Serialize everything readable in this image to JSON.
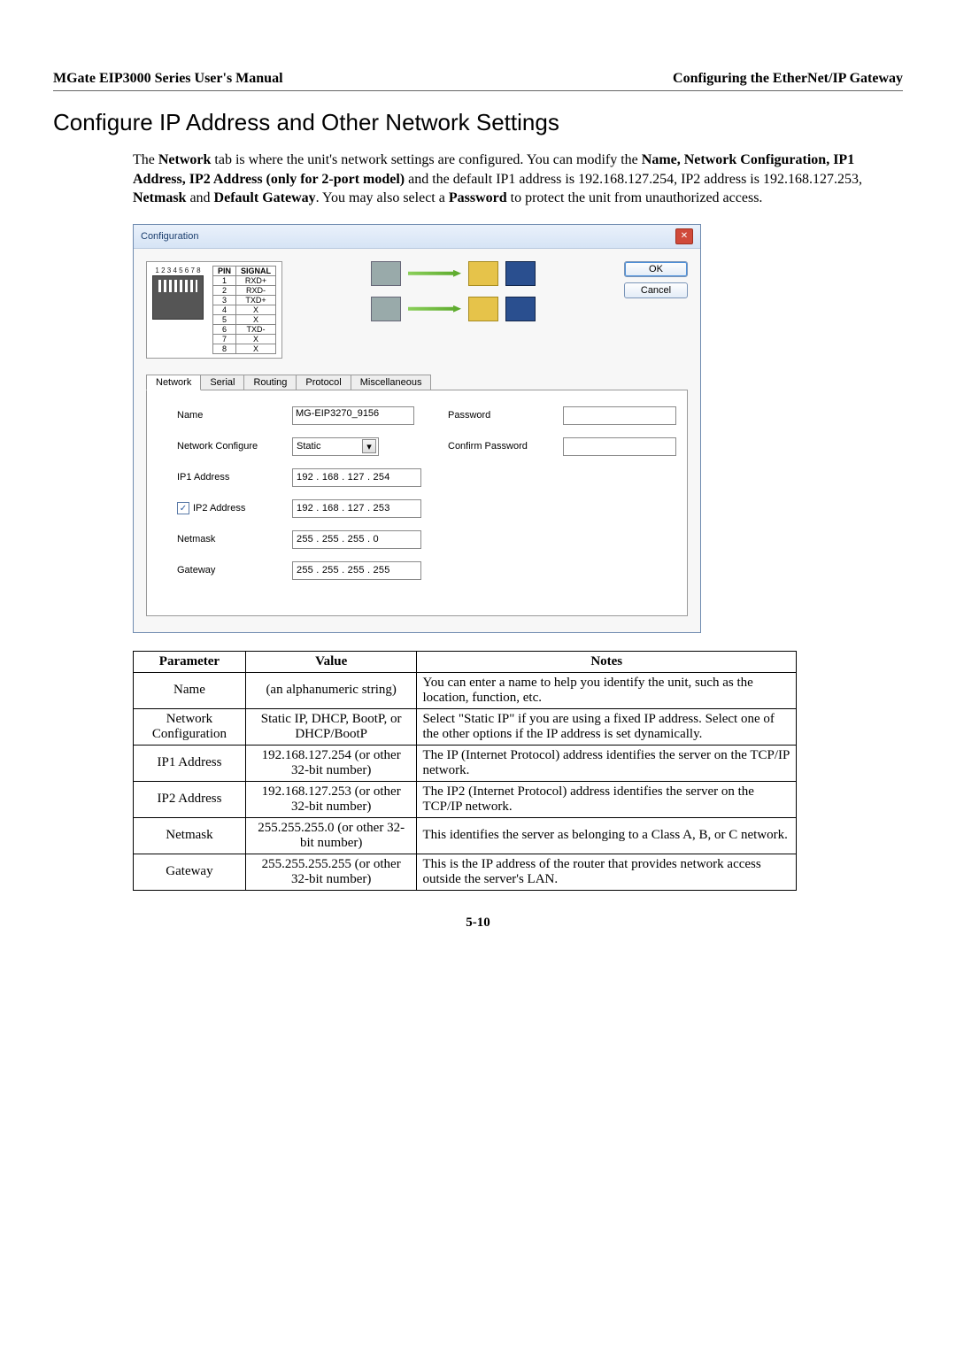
{
  "header": {
    "left": "MGate EIP3000 Series User's Manual",
    "right": "Configuring the EtherNet/IP Gateway"
  },
  "section_title": "Configure IP Address and Other Network Settings",
  "intro": {
    "t1": "The ",
    "b1": "Network",
    "t2": " tab is where the unit's network settings are configured. You can modify the ",
    "b2": "Name, Network Configuration, IP1 Address, IP2 Address (only for 2-port model)",
    "t3": " and the default IP1 address is 192.168.127.254, IP2 address is 192.168.127.253, ",
    "b3": "Netmask",
    "t4": " and ",
    "b4": "Default Gateway",
    "t5": ". You may also select a ",
    "b5": "Password",
    "t6": " to protect the unit from unauthorized access."
  },
  "dialog": {
    "title": "Configuration",
    "ok": "OK",
    "cancel": "Cancel",
    "rj45_nums": "1 2 3 4 5 6 7 8",
    "pin_header_pin": "PIN",
    "pin_header_signal": "SIGNAL",
    "pins": [
      {
        "n": "1",
        "s": "RXD+"
      },
      {
        "n": "2",
        "s": "RXD-"
      },
      {
        "n": "3",
        "s": "TXD+"
      },
      {
        "n": "4",
        "s": "X"
      },
      {
        "n": "5",
        "s": "X"
      },
      {
        "n": "6",
        "s": "TXD-"
      },
      {
        "n": "7",
        "s": "X"
      },
      {
        "n": "8",
        "s": "X"
      }
    ],
    "tabs": {
      "network": "Network",
      "serial": "Serial",
      "routing": "Routing",
      "protocol": "Protocol",
      "misc": "Miscellaneous"
    },
    "form": {
      "name_label": "Name",
      "name_value": "MG-EIP3270_9156",
      "netcfg_label": "Network Configure",
      "netcfg_value": "Static",
      "ip1_label": "IP1 Address",
      "ip1_value": "192 . 168 . 127 . 254",
      "ip2_label": "IP2 Address",
      "ip2_value": "192 . 168 . 127 . 253",
      "ip2_checked": "✓",
      "netmask_label": "Netmask",
      "netmask_value": "255 . 255 . 255 .   0",
      "gateway_label": "Gateway",
      "gateway_value": "255 . 255 . 255 . 255",
      "password_label": "Password",
      "confirm_label": "Confirm Password"
    }
  },
  "table": {
    "headers": {
      "param": "Parameter",
      "value": "Value",
      "notes": "Notes"
    },
    "rows": [
      {
        "param": "Name",
        "value": "(an alphanumeric string)",
        "notes": "You can enter a name to help you identify the unit, such as the location, function, etc."
      },
      {
        "param": "Network Configuration",
        "value": "Static IP, DHCP, BootP, or DHCP/BootP",
        "notes": "Select \"Static IP\" if you are using a fixed IP address. Select one of the other options if the IP address is set dynamically."
      },
      {
        "param": "IP1 Address",
        "value": "192.168.127.254\n(or other 32-bit number)",
        "notes": "The IP (Internet Protocol) address identifies the server on the TCP/IP network."
      },
      {
        "param": "IP2 Address",
        "value": "192.168.127.253\n(or other 32-bit number)",
        "notes": "The IP2 (Internet Protocol) address identifies the server on the TCP/IP network."
      },
      {
        "param": "Netmask",
        "value": "255.255.255.0\n(or other 32-bit number)",
        "notes": "This identifies the server as belonging to a Class A, B, or C network."
      },
      {
        "param": "Gateway",
        "value": "255.255.255.255\n(or other 32-bit number)",
        "notes": "This is the IP address of the router that provides network access outside the server's LAN."
      }
    ]
  },
  "page_number": "5-10"
}
